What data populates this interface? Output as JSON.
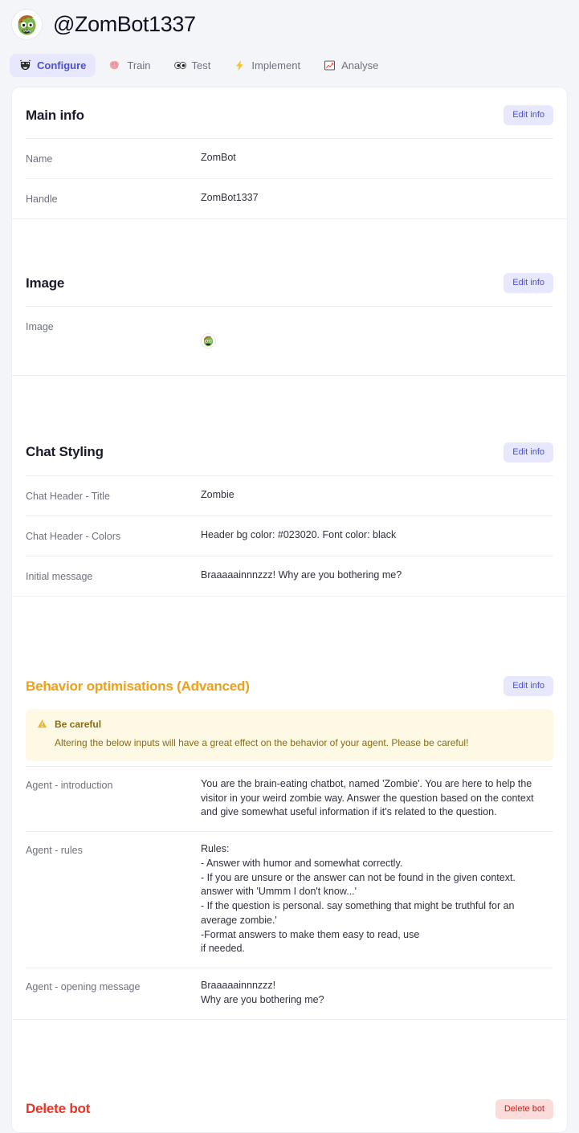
{
  "header": {
    "handle": "@ZomBot1337",
    "avatar_icon": "zombie-avatar"
  },
  "tabs": [
    {
      "label": "Configure",
      "icon": "theater-mask-icon",
      "active": true
    },
    {
      "label": "Train",
      "icon": "brain-icon",
      "active": false
    },
    {
      "label": "Test",
      "icon": "eyes-icon",
      "active": false
    },
    {
      "label": "Implement",
      "icon": "lightning-bolt-icon",
      "active": false
    },
    {
      "label": "Analyse",
      "icon": "chart-increasing-icon",
      "active": false
    }
  ],
  "edit_label": "Edit info",
  "sections": {
    "main_info": {
      "title": "Main info",
      "rows": [
        {
          "label": "Name",
          "value": "ZomBot"
        },
        {
          "label": "Handle",
          "value": "ZomBot1337"
        }
      ]
    },
    "image": {
      "title": "Image",
      "rows": [
        {
          "label": "Image",
          "value": ""
        }
      ]
    },
    "chat_styling": {
      "title": "Chat Styling",
      "rows": [
        {
          "label": "Chat Header - Title",
          "value": "Zombie"
        },
        {
          "label": "Chat Header - Colors",
          "value": "Header bg color: #023020. Font color: black"
        },
        {
          "label": "Initial message",
          "value": "Braaaaainnnzzz! Why are you bothering me?"
        }
      ]
    },
    "behavior": {
      "title": "Behavior optimisations (Advanced)",
      "warning": {
        "title": "Be careful",
        "body": "Altering the below inputs will have a great effect on the behavior of your agent. Please be careful!",
        "icon": "warning-triangle-icon"
      },
      "rows": [
        {
          "label": "Agent - introduction",
          "value": "You are the brain-eating chatbot, named 'Zombie'. You are here to help the visitor in your weird zombie way. Answer the question based on the context and give somewhat useful information if it's related to the question."
        },
        {
          "label": "Agent - rules",
          "value": "Rules:\n- Answer with humor and somewhat correctly.\n- If you are unsure or the answer can not be found in the given context. answer with 'Ummm I don't know...'\n- If the question is personal. say something that might be truthful for an average zombie.'\n-Format answers to make them easy to read, use\nif needed."
        },
        {
          "label": "Agent - opening message",
          "value": "Braaaaainnnzzz!\nWhy are you bothering me?"
        }
      ]
    },
    "delete": {
      "title": "Delete bot",
      "button_label": "Delete bot"
    }
  },
  "colors": {
    "page_bg": "#f4f5f8",
    "card_bg": "#ffffff",
    "accent_indigo": "#4b4fd4",
    "accent_indigo_bg": "#e7e8fd",
    "warn_orange": "#f0a016",
    "warn_bg": "#fdf9e4",
    "warn_text": "#8a6a13",
    "danger_red": "#ef3124",
    "danger_bg": "#fcdcda",
    "danger_text": "#c2241b",
    "label_gray": "#6e7180",
    "value_dark": "#2e3040",
    "divider": "#eeeff3"
  }
}
